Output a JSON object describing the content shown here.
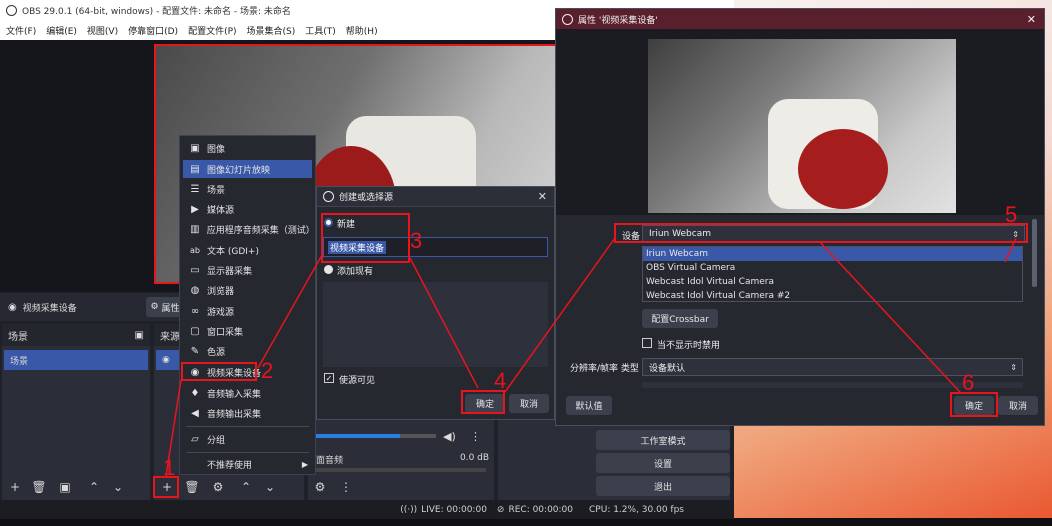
{
  "main": {
    "title": "OBS 29.0.1 (64-bit, windows) - 配置文件: 未命名 - 场景: 未命名",
    "menu": [
      "文件(F)",
      "编辑(E)",
      "视图(V)",
      "停靠窗口(D)",
      "配置文件(P)",
      "场景集合(S)",
      "工具(T)",
      "帮助(H)"
    ],
    "source_bar_label": "视频采集设备",
    "properties_label": "属性",
    "scenes_title": "场景",
    "scene_item": "场景",
    "sources_title": "来源",
    "mixer_track": "面音频",
    "mixer_level": "0.0 dB",
    "controls": [
      "工作室模式",
      "设置",
      "退出"
    ],
    "status": {
      "live": "LIVE: 00:00:00",
      "rec": "REC: 00:00:00",
      "cpu": "CPU: 1.2%, 30.00 fps"
    }
  },
  "menu_items": [
    {
      "icon": "image-icon",
      "glyph": "▣",
      "label": "图像"
    },
    {
      "icon": "slideshow-icon",
      "glyph": "▤",
      "label": "图像幻灯片放映"
    },
    {
      "icon": "scene-list-icon",
      "glyph": "☰",
      "label": "场景"
    },
    {
      "icon": "play-icon",
      "glyph": "▶",
      "label": "媒体源"
    },
    {
      "icon": "app-audio-icon",
      "glyph": "▥",
      "label": "应用程序音频采集（测试）"
    },
    {
      "icon": "text-icon",
      "glyph": "ab",
      "label": "文本 (GDI+)"
    },
    {
      "icon": "monitor-icon",
      "glyph": "▭",
      "label": "显示器采集"
    },
    {
      "icon": "globe-icon",
      "glyph": "◍",
      "label": "浏览器"
    },
    {
      "icon": "gamepad-icon",
      "glyph": "∞",
      "label": "游戏源"
    },
    {
      "icon": "window-icon",
      "glyph": "▢",
      "label": "窗口采集"
    },
    {
      "icon": "brush-icon",
      "glyph": "✎",
      "label": "色源"
    },
    {
      "icon": "camera-icon",
      "glyph": "◉",
      "label": "视频采集设备"
    },
    {
      "icon": "microphone-icon",
      "glyph": "♦",
      "label": "音频输入采集"
    },
    {
      "icon": "speaker-icon",
      "glyph": "◀",
      "label": "音频输出采集"
    }
  ],
  "menu_group": {
    "icon": "folder-icon",
    "glyph": "▱",
    "label": "分组"
  },
  "menu_deprecated": {
    "label": "不推荐使用"
  },
  "create_dialog": {
    "title": "创建或选择源",
    "new_label": "新建",
    "name_value": "视频采集设备",
    "add_existing": "添加现有",
    "visible_label": "使源可见",
    "ok": "确定",
    "cancel": "取消"
  },
  "props_dialog": {
    "title": "属性 '视频采集设备'",
    "device_label": "设备",
    "device_value": "Iriun Webcam",
    "device_options": [
      "Iriun Webcam",
      "OBS Virtual Camera",
      "Webcast Idol Virtual Camera",
      "Webcast Idol Virtual Camera #2"
    ],
    "crossbar": "配置Crossbar",
    "deactivate_label": "当不显示时禁用",
    "resolution_label": "分辨率/帧率 类型",
    "resolution_value": "设备默认",
    "defaults": "默认值",
    "ok": "确定",
    "cancel": "取消"
  },
  "steps": [
    "1",
    "2",
    "3",
    "4",
    "5",
    "6"
  ],
  "colors": {
    "accent": "#3a58a8",
    "annotation": "#e8141e",
    "titlebar_dark": "#5a1f2c"
  }
}
